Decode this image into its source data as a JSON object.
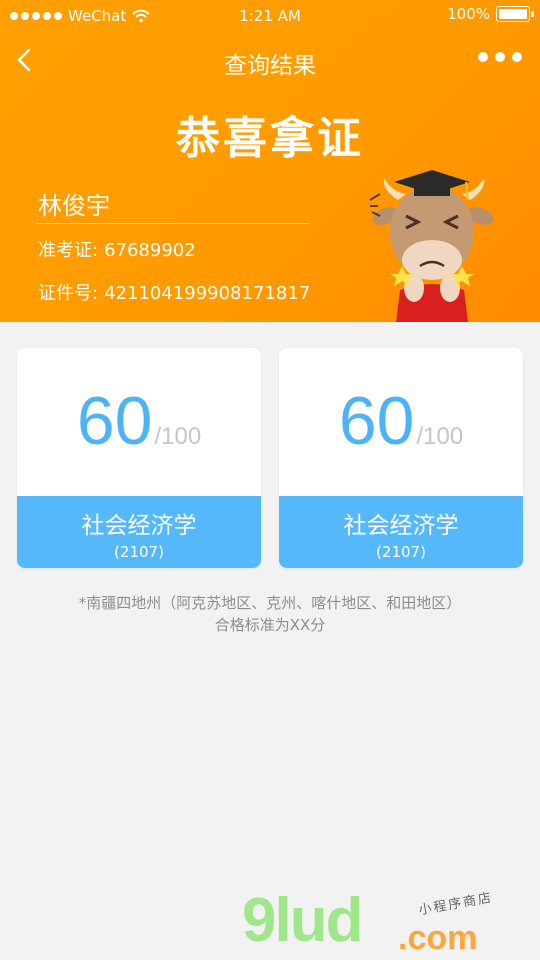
{
  "status_bar": {
    "carrier": "WeChat",
    "time": "1:21 AM",
    "battery": "100%"
  },
  "nav": {
    "title": "查询结果"
  },
  "header": {
    "congrats": "恭喜拿证",
    "name": "林俊宇",
    "exam_no_label": "准考证:",
    "exam_no": "67689902",
    "cert_no_label": "证件号:",
    "cert_no": "421104199908171817"
  },
  "cards": [
    {
      "score": "60",
      "total": "/100",
      "subject": "社会经济学",
      "code": "(2107)"
    },
    {
      "score": "60",
      "total": "/100",
      "subject": "社会经济学",
      "code": "(2107)"
    }
  ],
  "note": {
    "line1": "*南疆四地州（阿克苏地区、克州、喀什地区、和田地区）",
    "line2": "合格标准为XX分"
  },
  "watermark": {
    "main": "9lud",
    "domain": ".com",
    "tagline": "小程序商店"
  },
  "colors": {
    "header_bg": "#ff9c00",
    "score_blue": "#4db3f7",
    "subject_bar": "#55b8fa",
    "page_bg": "#f2f2f2"
  },
  "icons": [
    "signal-dots-icon",
    "wifi-icon",
    "battery-icon",
    "back-chevron-icon",
    "more-dots-icon",
    "mascot-cow-graduate"
  ]
}
